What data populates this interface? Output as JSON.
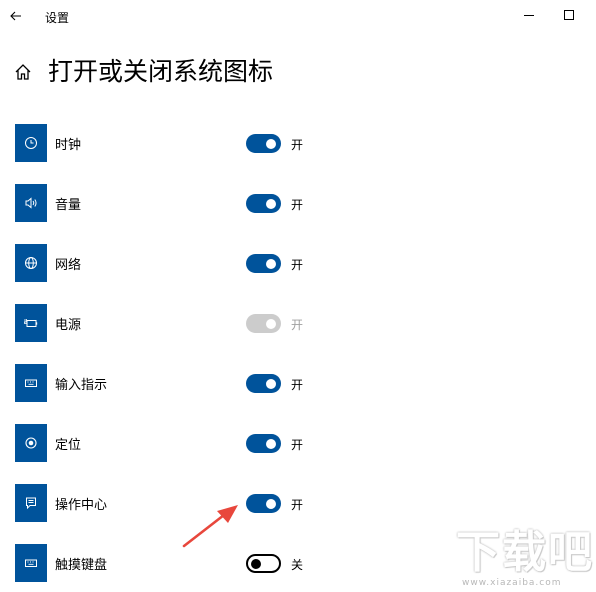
{
  "window": {
    "title": "设置"
  },
  "page": {
    "title": "打开或关闭系统图标"
  },
  "items": [
    {
      "label": "时钟",
      "state": "on",
      "state_label": "开",
      "icon": "clock-icon"
    },
    {
      "label": "音量",
      "state": "on",
      "state_label": "开",
      "icon": "volume-icon"
    },
    {
      "label": "网络",
      "state": "on",
      "state_label": "开",
      "icon": "globe-icon"
    },
    {
      "label": "电源",
      "state": "disabled-on",
      "state_label": "开",
      "icon": "battery-plug-icon"
    },
    {
      "label": "输入指示",
      "state": "on",
      "state_label": "开",
      "icon": "keyboard-icon"
    },
    {
      "label": "定位",
      "state": "on",
      "state_label": "开",
      "icon": "location-icon"
    },
    {
      "label": "操作中心",
      "state": "on",
      "state_label": "开",
      "icon": "action-center-icon"
    },
    {
      "label": "触摸键盘",
      "state": "off",
      "state_label": "关",
      "icon": "keyboard-icon"
    }
  ],
  "watermark": {
    "text": "下载吧",
    "url": "www.xiazaiba.com"
  },
  "colors": {
    "accent": "#00539b",
    "disabled": "#cccccc",
    "annotation": "#e8473c"
  }
}
